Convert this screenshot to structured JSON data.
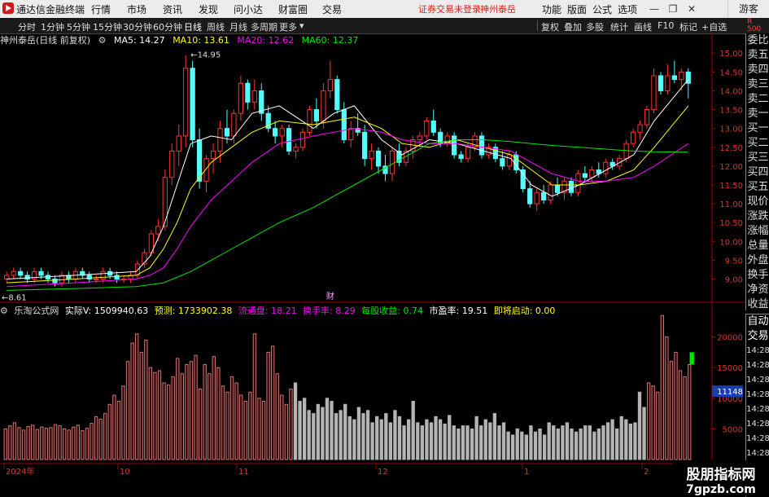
{
  "app": {
    "title": "通达信金融终端"
  },
  "menu": [
    "行情",
    "市场",
    "资讯",
    "发现",
    "问小达",
    "财富圈",
    "交易"
  ],
  "status": {
    "login": "证券交易未登录",
    "stock": "神州泰岳"
  },
  "top_right": [
    "功能",
    "版面",
    "公式",
    "选项"
  ],
  "guest": "游客",
  "periods": [
    "分时",
    "1分钟",
    "5分钟",
    "15分钟",
    "30分钟",
    "60分钟",
    "日线",
    "周线",
    "月线",
    "多周期",
    "更多"
  ],
  "tools": [
    "复权",
    "叠加",
    "多股",
    "统计",
    "画线",
    "F10",
    "标记",
    "+自选"
  ],
  "main_info": {
    "name": "神州泰岳(日线 前复权)",
    "ma5": "MA5: 14.27",
    "ma10": "MA10: 13.61",
    "ma20": "MA20: 12.62",
    "ma60": "MA60: 12.37"
  },
  "annotations": {
    "high": "14.95",
    "low": "8.61",
    "events": [
      "财",
      "减",
      "预"
    ]
  },
  "vol_info": {
    "name": "乐淘公式网",
    "actual": "实际V: 1509940.63",
    "forecast": "预测: 1733902.38",
    "float": "流通盘: 18.21",
    "turnover": "换手率: 8.29",
    "eps": "每股收益: 0.74",
    "pe": "市盈率: 19.51",
    "start": "即将启动: 0.00"
  },
  "price_axis": [
    "15.00",
    "14.50",
    "14.00",
    "13.50",
    "13.00",
    "12.50",
    "12.00",
    "11.50",
    "11.00",
    "10.50",
    "10.00",
    "9.50",
    "9.00"
  ],
  "vol_axis": [
    "20000",
    "15000",
    "10000",
    "5000"
  ],
  "vol_current": "11148",
  "x_axis": [
    "2024年",
    "10",
    "11",
    "12",
    "1",
    "2"
  ],
  "right_panel": [
    "委比",
    "卖五",
    "卖四",
    "卖三",
    "卖二",
    "卖一",
    "买一",
    "买二",
    "买三",
    "买四",
    "买五",
    "现价",
    "涨跌",
    "涨幅",
    "总量",
    "外盘",
    "换手",
    "净资",
    "收益"
  ],
  "right_panel_low": [
    "自动",
    "交易",
    "14:28",
    "14:28",
    "14:28",
    "14:28",
    "14:28",
    "14:28",
    "14:28",
    "14:28",
    "14:28"
  ],
  "watermark": {
    "line1": "股朋指标网",
    "line2": "7gpzb.com"
  },
  "colors": {
    "up": "#ff3232",
    "down": "#54fcfc",
    "ma5": "#ffffff",
    "ma10": "#ffff00",
    "ma20": "#ff00ff",
    "ma60": "#00e600",
    "volgray": "#b4b4b4"
  },
  "chart_data": [
    {
      "type": "candlestick",
      "price_range": [
        8.6,
        15.2
      ],
      "candles": [
        [
          9.0,
          9.2,
          8.9,
          9.1
        ],
        [
          9.1,
          9.3,
          9.0,
          9.2
        ],
        [
          9.2,
          9.3,
          9.0,
          9.1
        ],
        [
          9.1,
          9.2,
          8.9,
          9.0
        ],
        [
          9.0,
          9.3,
          8.9,
          9.2
        ],
        [
          9.2,
          9.3,
          9.0,
          9.1
        ],
        [
          9.1,
          9.2,
          8.9,
          9.0
        ],
        [
          9.0,
          9.1,
          8.8,
          8.9
        ],
        [
          8.9,
          9.2,
          8.8,
          9.1
        ],
        [
          9.1,
          9.2,
          8.9,
          9.0
        ],
        [
          9.0,
          9.3,
          8.9,
          9.2
        ],
        [
          9.2,
          9.3,
          9.0,
          9.1
        ],
        [
          9.1,
          9.2,
          8.9,
          9.0
        ],
        [
          9.0,
          9.1,
          8.9,
          9.0
        ],
        [
          9.0,
          9.3,
          8.9,
          9.2
        ],
        [
          9.2,
          9.3,
          9.0,
          9.1
        ],
        [
          9.1,
          9.2,
          8.9,
          9.0
        ],
        [
          9.0,
          9.1,
          8.9,
          9.0
        ],
        [
          9.0,
          9.2,
          8.9,
          9.1
        ],
        [
          9.1,
          9.5,
          9.0,
          9.4
        ],
        [
          9.4,
          9.8,
          9.3,
          9.7
        ],
        [
          9.7,
          10.3,
          9.6,
          10.2
        ],
        [
          10.2,
          10.6,
          10.0,
          10.4
        ],
        [
          10.4,
          11.9,
          10.3,
          11.7
        ],
        [
          11.7,
          12.6,
          11.5,
          12.4
        ],
        [
          12.4,
          13.1,
          12.0,
          12.8
        ],
        [
          12.8,
          14.95,
          12.5,
          14.6
        ],
        [
          14.6,
          14.8,
          12.5,
          12.7
        ],
        [
          12.7,
          13.0,
          11.4,
          11.6
        ],
        [
          11.6,
          12.3,
          11.3,
          12.2
        ],
        [
          12.2,
          12.6,
          11.8,
          12.4
        ],
        [
          12.4,
          13.2,
          12.1,
          13.0
        ],
        [
          13.0,
          13.5,
          12.6,
          12.8
        ],
        [
          12.8,
          13.5,
          12.6,
          13.4
        ],
        [
          13.4,
          14.4,
          13.2,
          14.2
        ],
        [
          14.2,
          14.3,
          13.5,
          13.7
        ],
        [
          13.7,
          14.3,
          13.5,
          14.0
        ],
        [
          14.0,
          14.2,
          13.2,
          13.4
        ],
        [
          13.4,
          13.6,
          12.9,
          13.0
        ],
        [
          13.0,
          13.2,
          12.6,
          12.8
        ],
        [
          12.8,
          13.1,
          12.5,
          13.0
        ],
        [
          13.0,
          13.1,
          12.3,
          12.4
        ],
        [
          12.4,
          12.6,
          12.2,
          12.5
        ],
        [
          12.5,
          13.0,
          12.4,
          12.9
        ],
        [
          12.9,
          13.6,
          12.8,
          13.5
        ],
        [
          13.5,
          13.8,
          13.0,
          13.2
        ],
        [
          13.2,
          14.2,
          13.0,
          14.0
        ],
        [
          14.0,
          14.8,
          13.8,
          14.3
        ],
        [
          14.3,
          14.4,
          13.4,
          13.5
        ],
        [
          13.5,
          13.7,
          12.6,
          12.7
        ],
        [
          12.7,
          13.2,
          12.5,
          13.0
        ],
        [
          13.0,
          13.4,
          12.8,
          12.9
        ],
        [
          12.9,
          13.1,
          12.0,
          12.2
        ],
        [
          12.2,
          12.6,
          11.9,
          12.4
        ],
        [
          12.4,
          12.5,
          11.8,
          12.0
        ],
        [
          12.0,
          12.3,
          11.6,
          11.8
        ],
        [
          11.8,
          12.5,
          11.6,
          12.4
        ],
        [
          12.4,
          12.6,
          12.0,
          12.1
        ],
        [
          12.1,
          12.5,
          12.0,
          12.4
        ],
        [
          12.4,
          12.8,
          12.2,
          12.7
        ],
        [
          12.7,
          12.9,
          12.5,
          12.8
        ],
        [
          12.8,
          13.3,
          12.7,
          13.2
        ],
        [
          13.2,
          13.5,
          12.8,
          12.9
        ],
        [
          12.9,
          13.0,
          12.5,
          12.6
        ],
        [
          12.6,
          12.9,
          12.5,
          12.8
        ],
        [
          12.8,
          12.9,
          12.2,
          12.3
        ],
        [
          12.3,
          12.4,
          12.1,
          12.2
        ],
        [
          12.2,
          12.6,
          12.1,
          12.5
        ],
        [
          12.5,
          12.9,
          12.4,
          12.8
        ],
        [
          12.8,
          12.9,
          12.2,
          12.3
        ],
        [
          12.3,
          12.6,
          12.2,
          12.5
        ],
        [
          12.5,
          12.6,
          12.1,
          12.2
        ],
        [
          12.2,
          12.4,
          11.9,
          12.0
        ],
        [
          12.0,
          12.4,
          11.9,
          12.3
        ],
        [
          12.3,
          12.4,
          11.8,
          11.9
        ],
        [
          11.9,
          12.0,
          11.3,
          11.4
        ],
        [
          11.4,
          11.6,
          10.9,
          11.0
        ],
        [
          11.0,
          11.4,
          10.8,
          11.3
        ],
        [
          11.3,
          11.5,
          11.0,
          11.1
        ],
        [
          11.1,
          11.6,
          11.0,
          11.5
        ],
        [
          11.5,
          11.7,
          11.2,
          11.3
        ],
        [
          11.3,
          11.7,
          11.1,
          11.6
        ],
        [
          11.6,
          11.7,
          11.2,
          11.3
        ],
        [
          11.3,
          11.9,
          11.2,
          11.8
        ],
        [
          11.8,
          12.0,
          11.6,
          11.7
        ],
        [
          11.7,
          12.0,
          11.6,
          11.9
        ],
        [
          11.9,
          12.1,
          11.7,
          11.8
        ],
        [
          11.8,
          12.2,
          11.7,
          12.1
        ],
        [
          12.1,
          12.2,
          11.9,
          12.0
        ],
        [
          12.0,
          12.3,
          11.9,
          12.2
        ],
        [
          12.2,
          12.7,
          12.1,
          12.6
        ],
        [
          12.6,
          13.0,
          12.5,
          12.9
        ],
        [
          12.9,
          13.2,
          12.7,
          13.1
        ],
        [
          13.1,
          13.6,
          13.0,
          13.5
        ],
        [
          13.5,
          14.6,
          13.4,
          14.4
        ],
        [
          14.4,
          14.5,
          13.9,
          14.0
        ],
        [
          14.0,
          14.7,
          13.9,
          14.4
        ],
        [
          14.4,
          14.8,
          14.2,
          14.3
        ],
        [
          14.3,
          14.6,
          14.0,
          14.5
        ],
        [
          14.5,
          14.6,
          13.8,
          14.2
        ]
      ],
      "ma": {
        "MA5": [
          [
            0,
            9.0
          ],
          [
            10,
            9.1
          ],
          [
            19,
            9.2
          ],
          [
            21,
            9.6
          ],
          [
            23,
            10.4
          ],
          [
            25,
            11.5
          ],
          [
            27,
            12.6
          ],
          [
            30,
            12.8
          ],
          [
            33,
            12.7
          ],
          [
            36,
            13.4
          ],
          [
            40,
            13.6
          ],
          [
            45,
            13.0
          ],
          [
            48,
            13.4
          ],
          [
            51,
            13.6
          ],
          [
            55,
            12.7
          ],
          [
            58,
            12.3
          ],
          [
            62,
            12.7
          ],
          [
            66,
            12.6
          ],
          [
            70,
            12.4
          ],
          [
            74,
            12.2
          ],
          [
            77,
            11.5
          ],
          [
            80,
            11.2
          ],
          [
            84,
            11.5
          ],
          [
            88,
            11.9
          ],
          [
            92,
            12.3
          ],
          [
            95,
            13.2
          ],
          [
            100,
            14.3
          ]
        ],
        "MA10": [
          [
            0,
            8.9
          ],
          [
            10,
            9.0
          ],
          [
            19,
            9.1
          ],
          [
            21,
            9.3
          ],
          [
            23,
            9.8
          ],
          [
            25,
            10.5
          ],
          [
            27,
            11.4
          ],
          [
            30,
            12.1
          ],
          [
            33,
            12.5
          ],
          [
            36,
            12.9
          ],
          [
            40,
            13.2
          ],
          [
            45,
            13.1
          ],
          [
            48,
            13.2
          ],
          [
            51,
            13.3
          ],
          [
            55,
            13.0
          ],
          [
            58,
            12.6
          ],
          [
            62,
            12.5
          ],
          [
            66,
            12.7
          ],
          [
            70,
            12.5
          ],
          [
            74,
            12.3
          ],
          [
            77,
            11.9
          ],
          [
            80,
            11.5
          ],
          [
            84,
            11.5
          ],
          [
            88,
            11.6
          ],
          [
            92,
            11.9
          ],
          [
            95,
            12.5
          ],
          [
            100,
            13.6
          ]
        ],
        "MA20": [
          [
            0,
            8.8
          ],
          [
            10,
            8.9
          ],
          [
            19,
            9.0
          ],
          [
            21,
            9.1
          ],
          [
            23,
            9.3
          ],
          [
            25,
            9.8
          ],
          [
            27,
            10.4
          ],
          [
            30,
            11.1
          ],
          [
            33,
            11.6
          ],
          [
            36,
            12.1
          ],
          [
            40,
            12.6
          ],
          [
            45,
            12.8
          ],
          [
            48,
            12.9
          ],
          [
            51,
            13.0
          ],
          [
            55,
            12.9
          ],
          [
            58,
            12.7
          ],
          [
            62,
            12.6
          ],
          [
            66,
            12.6
          ],
          [
            70,
            12.5
          ],
          [
            74,
            12.4
          ],
          [
            77,
            12.1
          ],
          [
            80,
            11.8
          ],
          [
            84,
            11.6
          ],
          [
            88,
            11.6
          ],
          [
            92,
            11.7
          ],
          [
            95,
            12.0
          ],
          [
            100,
            12.6
          ]
        ],
        "MA60": [
          [
            0,
            8.7
          ],
          [
            10,
            8.75
          ],
          [
            19,
            8.8
          ],
          [
            23,
            8.9
          ],
          [
            27,
            9.2
          ],
          [
            30,
            9.5
          ],
          [
            33,
            9.8
          ],
          [
            36,
            10.1
          ],
          [
            40,
            10.5
          ],
          [
            45,
            10.9
          ],
          [
            48,
            11.2
          ],
          [
            51,
            11.5
          ],
          [
            55,
            11.9
          ],
          [
            58,
            12.2
          ],
          [
            62,
            12.6
          ],
          [
            66,
            12.7
          ],
          [
            70,
            12.7
          ],
          [
            74,
            12.65
          ],
          [
            77,
            12.6
          ],
          [
            80,
            12.55
          ],
          [
            84,
            12.5
          ],
          [
            88,
            12.45
          ],
          [
            92,
            12.4
          ],
          [
            95,
            12.38
          ],
          [
            100,
            12.37
          ]
        ]
      }
    },
    {
      "type": "bar",
      "name": "volume",
      "ylim": [
        0,
        23000
      ],
      "values": [
        5000,
        5500,
        6000,
        5200,
        4800,
        5400,
        5600,
        4900,
        5300,
        5100,
        5200,
        5700,
        5500,
        5000,
        4800,
        5300,
        5600,
        4700,
        5100,
        5900,
        7000,
        6600,
        7500,
        9000,
        10500,
        9500,
        12000,
        16000,
        19000,
        20500,
        17500,
        19500,
        15000,
        14200,
        14500,
        12500,
        12200,
        13500,
        16500,
        14000,
        15500,
        16000,
        17000,
        11500,
        15500,
        14000,
        16800,
        15000,
        12000,
        11000,
        13500,
        12500,
        10500,
        9500,
        11000,
        20500,
        10000,
        9500,
        17500,
        18500,
        14000,
        10500,
        9000,
        11500,
        12500,
        9500,
        10000,
        8000,
        7500,
        9000,
        8500,
        10000,
        9500,
        7500,
        8000,
        9000,
        7000,
        6500,
        8500,
        7500,
        8000,
        6000,
        7000,
        6500,
        7500,
        6000,
        8000,
        7000,
        5500,
        6500,
        9500,
        6000,
        5500,
        6500,
        6000,
        7000,
        6500,
        5800,
        7200,
        5500,
        5000,
        5500,
        5500,
        5000,
        7000,
        5500,
        6500,
        6000,
        7500,
        5500,
        6000,
        4500,
        4000,
        5000,
        4500,
        4000,
        5500,
        4500,
        5000,
        4000,
        6000,
        5500,
        5000,
        5500,
        6000,
        5000,
        4500,
        5000,
        5500,
        5500,
        4500,
        5000,
        5500,
        6000,
        6500,
        5000,
        7000,
        6500,
        5800,
        6000,
        11000,
        8500,
        12500,
        12000,
        11000,
        23500,
        20000,
        16000,
        17500,
        14500,
        13500,
        15500
      ],
      "gray_range": [
        64,
        141
      ],
      "current": 11148
    }
  ]
}
